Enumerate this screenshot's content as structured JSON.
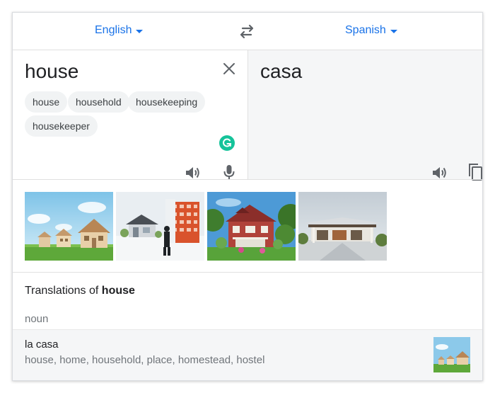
{
  "language_bar": {
    "source_language": "English",
    "target_language": "Spanish",
    "swap_icon": "swap-arrows-icon"
  },
  "source": {
    "text": "house",
    "suggestions": [
      "house",
      "household",
      "housekeeping",
      "housekeeper"
    ],
    "clear_icon": "close-icon",
    "listen_icon": "speaker-icon",
    "mic_icon": "microphone-icon",
    "extension_icon": "grammarly-icon"
  },
  "target": {
    "text": "casa",
    "listen_icon": "speaker-icon",
    "copy_icon": "copy-icon"
  },
  "images": [
    "toy-houses-image",
    "architecture-model-image",
    "red-house-image",
    "modern-villa-image"
  ],
  "translations": {
    "title_prefix": "Translations of ",
    "title_word": "house",
    "part_of_speech": "noun",
    "entries": [
      {
        "word": "la casa",
        "synonyms": "house, home, household, place, homestead, hostel"
      }
    ]
  },
  "colors": {
    "accent": "#1a73e8",
    "panel_bg": "#f5f6f7",
    "chip_bg": "#f1f3f4",
    "grammarly": "#15c39a"
  }
}
